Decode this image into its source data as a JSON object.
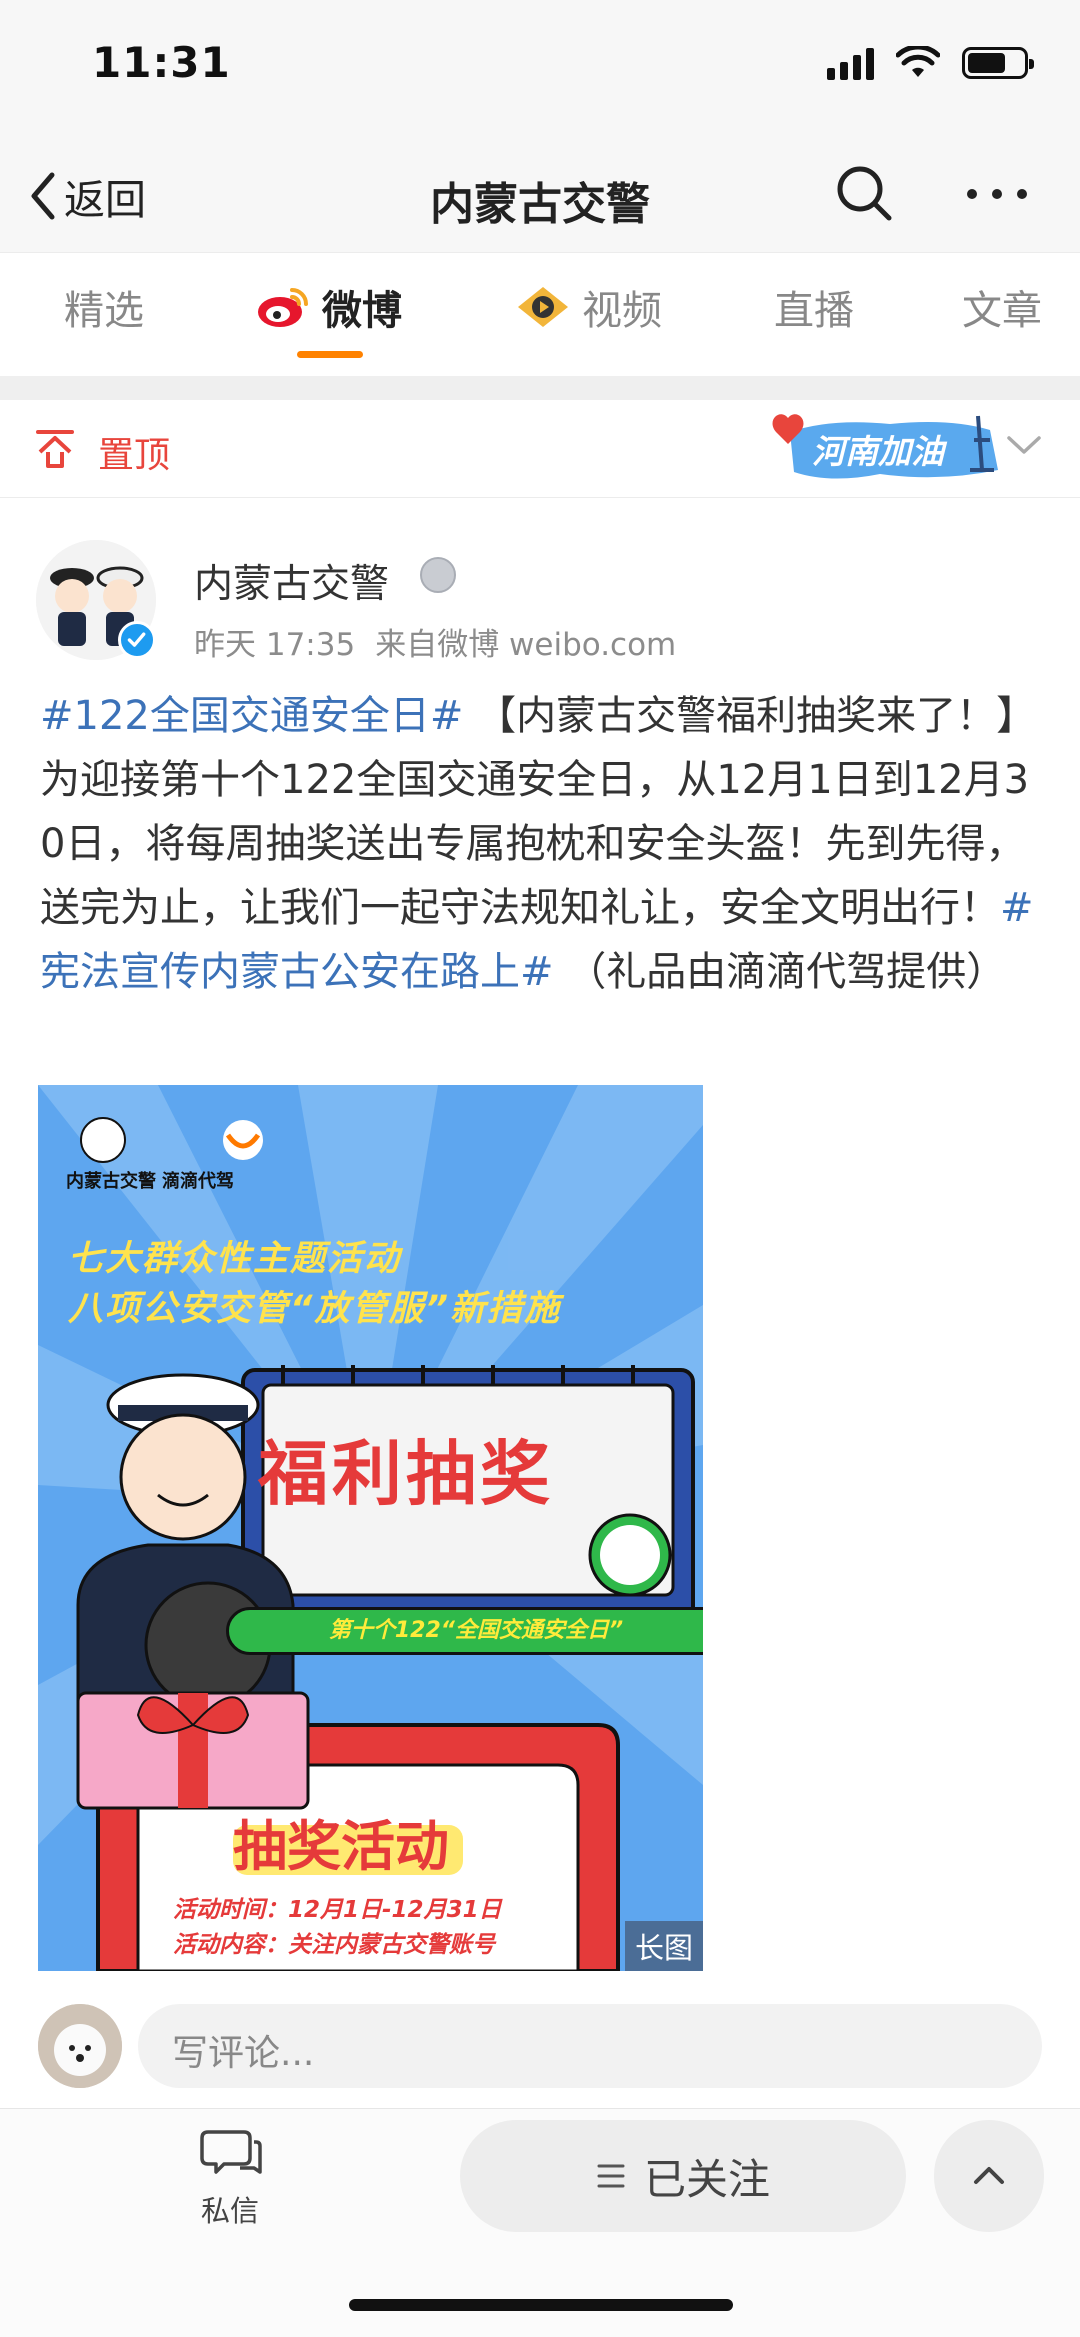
{
  "status_bar": {
    "time": "11:31",
    "battery_level": 0.68
  },
  "nav": {
    "back_label": "返回",
    "title": "内蒙古交警"
  },
  "tabs": [
    {
      "label": "精选",
      "active": false
    },
    {
      "label": "微博",
      "active": true
    },
    {
      "label": "视频",
      "active": false
    },
    {
      "label": "直播",
      "active": false
    },
    {
      "label": "文章",
      "active": false
    }
  ],
  "pinned": {
    "label": "置顶",
    "badge_text": "河南加油"
  },
  "post": {
    "author": "内蒙古交警",
    "time": "昨天 17:35",
    "source": "来自微博 weibo.com",
    "hashtag_1": "#122全国交通安全日#",
    "text_1": " 【内蒙古交警福利抽奖来了！】为迎接第十个122全国交通安全日，从12月1日到12月30日，将每周抽奖送出专属抱枕和安全头盔！先到先得，送完为止，让我们一起守法规知礼让，安全文明出行！",
    "hashtag_2": "#宪法宣传内蒙古公安在路上#",
    "text_2": " （礼品由滴滴代驾提供）",
    "image": {
      "long_label": "长图",
      "logo_left": "内蒙古交警",
      "logo_right": "滴滴代驾",
      "headline_1": "七大群众性主题活动",
      "headline_2": "八项公安交管“放管服”新措施",
      "main": "福利抽奖",
      "sub": "第十个122“全国交通安全日”",
      "lottery": "抽奖活动",
      "line_1": "活动时间：12月1日-12月31日",
      "line_2": "活动内容：关注内蒙古交警账号"
    }
  },
  "comment": {
    "placeholder": "写评论..."
  },
  "bottom": {
    "dm_label": "私信",
    "follow_label": "已关注"
  },
  "colors": {
    "accent_orange": "#ff8200",
    "link_blue": "#3c72b8",
    "pin_red": "#e8453c"
  }
}
